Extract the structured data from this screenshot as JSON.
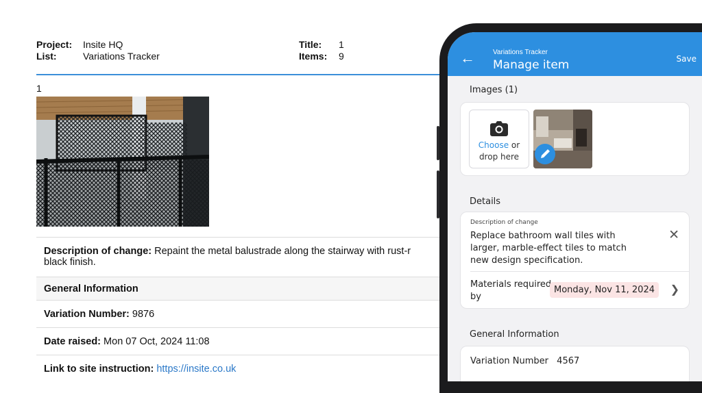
{
  "report": {
    "project_label": "Project:",
    "project_value": "Insite HQ",
    "list_label": "List:",
    "list_value": "Variations Tracker",
    "title_label": "Title:",
    "title_value": "1",
    "items_label": "Items:",
    "items_value": "9",
    "item_number": "1",
    "description_label": "Description of change:",
    "description_value": "Repaint the metal balustrade along the stairway with rust-r",
    "description_value_line2": "black finish.",
    "general_info_heading": "General Information",
    "variation_number_label": "Variation Number:",
    "variation_number_value": "9876",
    "date_raised_label": "Date raised:",
    "date_raised_value": "Mon 07 Oct, 2024 11:08",
    "link_label": "Link to site instruction:",
    "link_value": "https://insite.co.uk"
  },
  "app": {
    "subtitle": "Variations Tracker",
    "title": "Manage item",
    "save_label": "Save",
    "images_heading": "Images (1)",
    "choose_label": "Choose",
    "or_label": " or",
    "drop_label": "drop here",
    "details_heading": "Details",
    "description_caption": "Description of change",
    "description_value": "Replace bathroom wall tiles with larger, marble-effect tiles to match new design specification.",
    "materials_label": "Materials required by",
    "materials_date": "Monday, Nov 11, 2024",
    "general_info_heading": "General Information",
    "variation_number_label": "Variation Number",
    "variation_number_value": "4567"
  },
  "colors": {
    "accent": "#2d8fe0",
    "link": "#2a78c8",
    "date_chip_bg": "#fbe4e4",
    "rule": "#3b8fd9"
  },
  "icons": [
    "back-arrow-icon",
    "camera-icon",
    "edit-pencil-icon",
    "close-icon",
    "chevron-right-icon"
  ]
}
